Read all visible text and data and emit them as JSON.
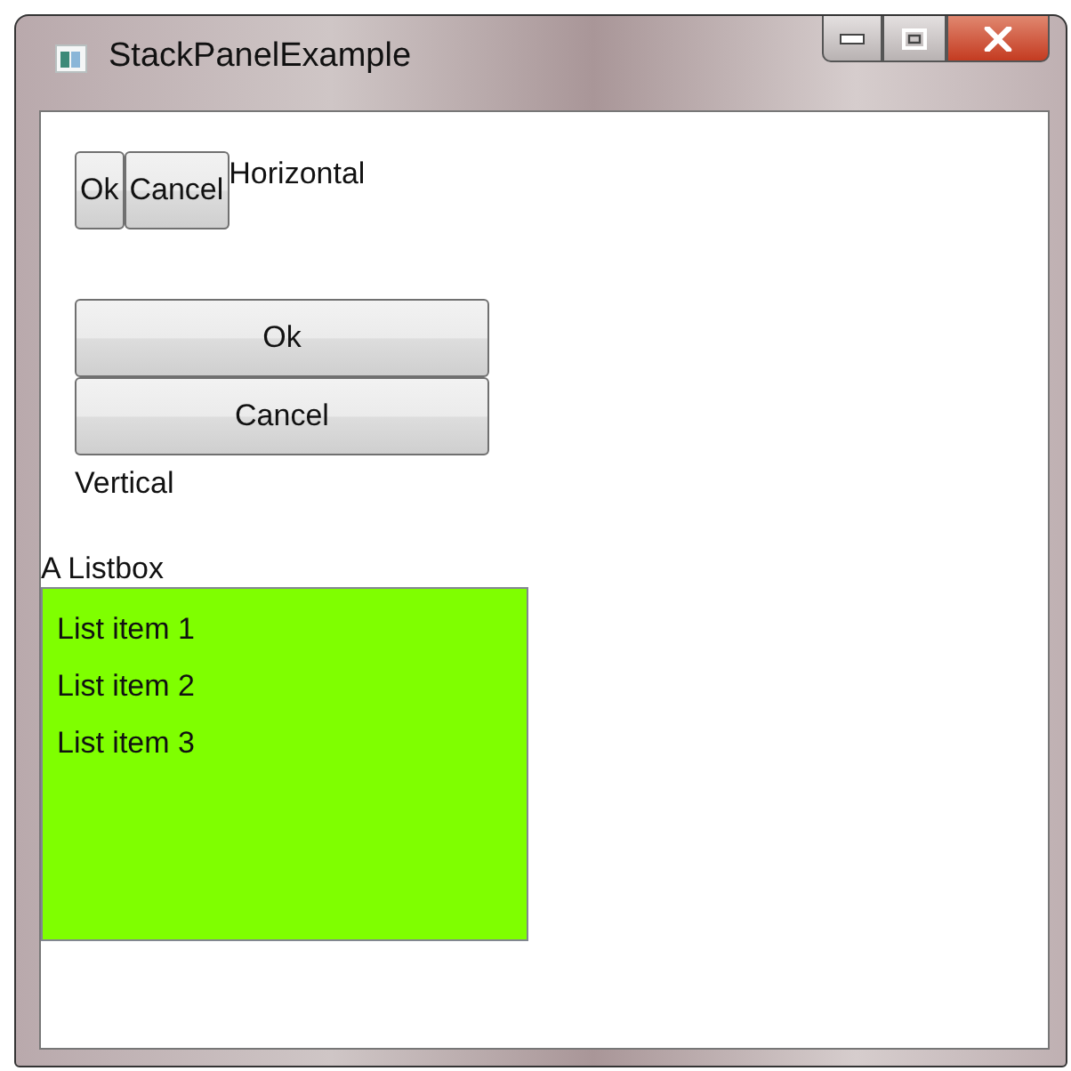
{
  "window": {
    "title": "StackPanelExample"
  },
  "horizontal_panel": {
    "buttons": [
      "Ok",
      "Cancel"
    ],
    "label": "Horizontal"
  },
  "vertical_panel": {
    "buttons": [
      "Ok",
      "Cancel"
    ],
    "label": "Vertical"
  },
  "listbox": {
    "label": "A Listbox",
    "items": [
      "List item 1",
      "List item 2",
      "List item 3"
    ]
  }
}
